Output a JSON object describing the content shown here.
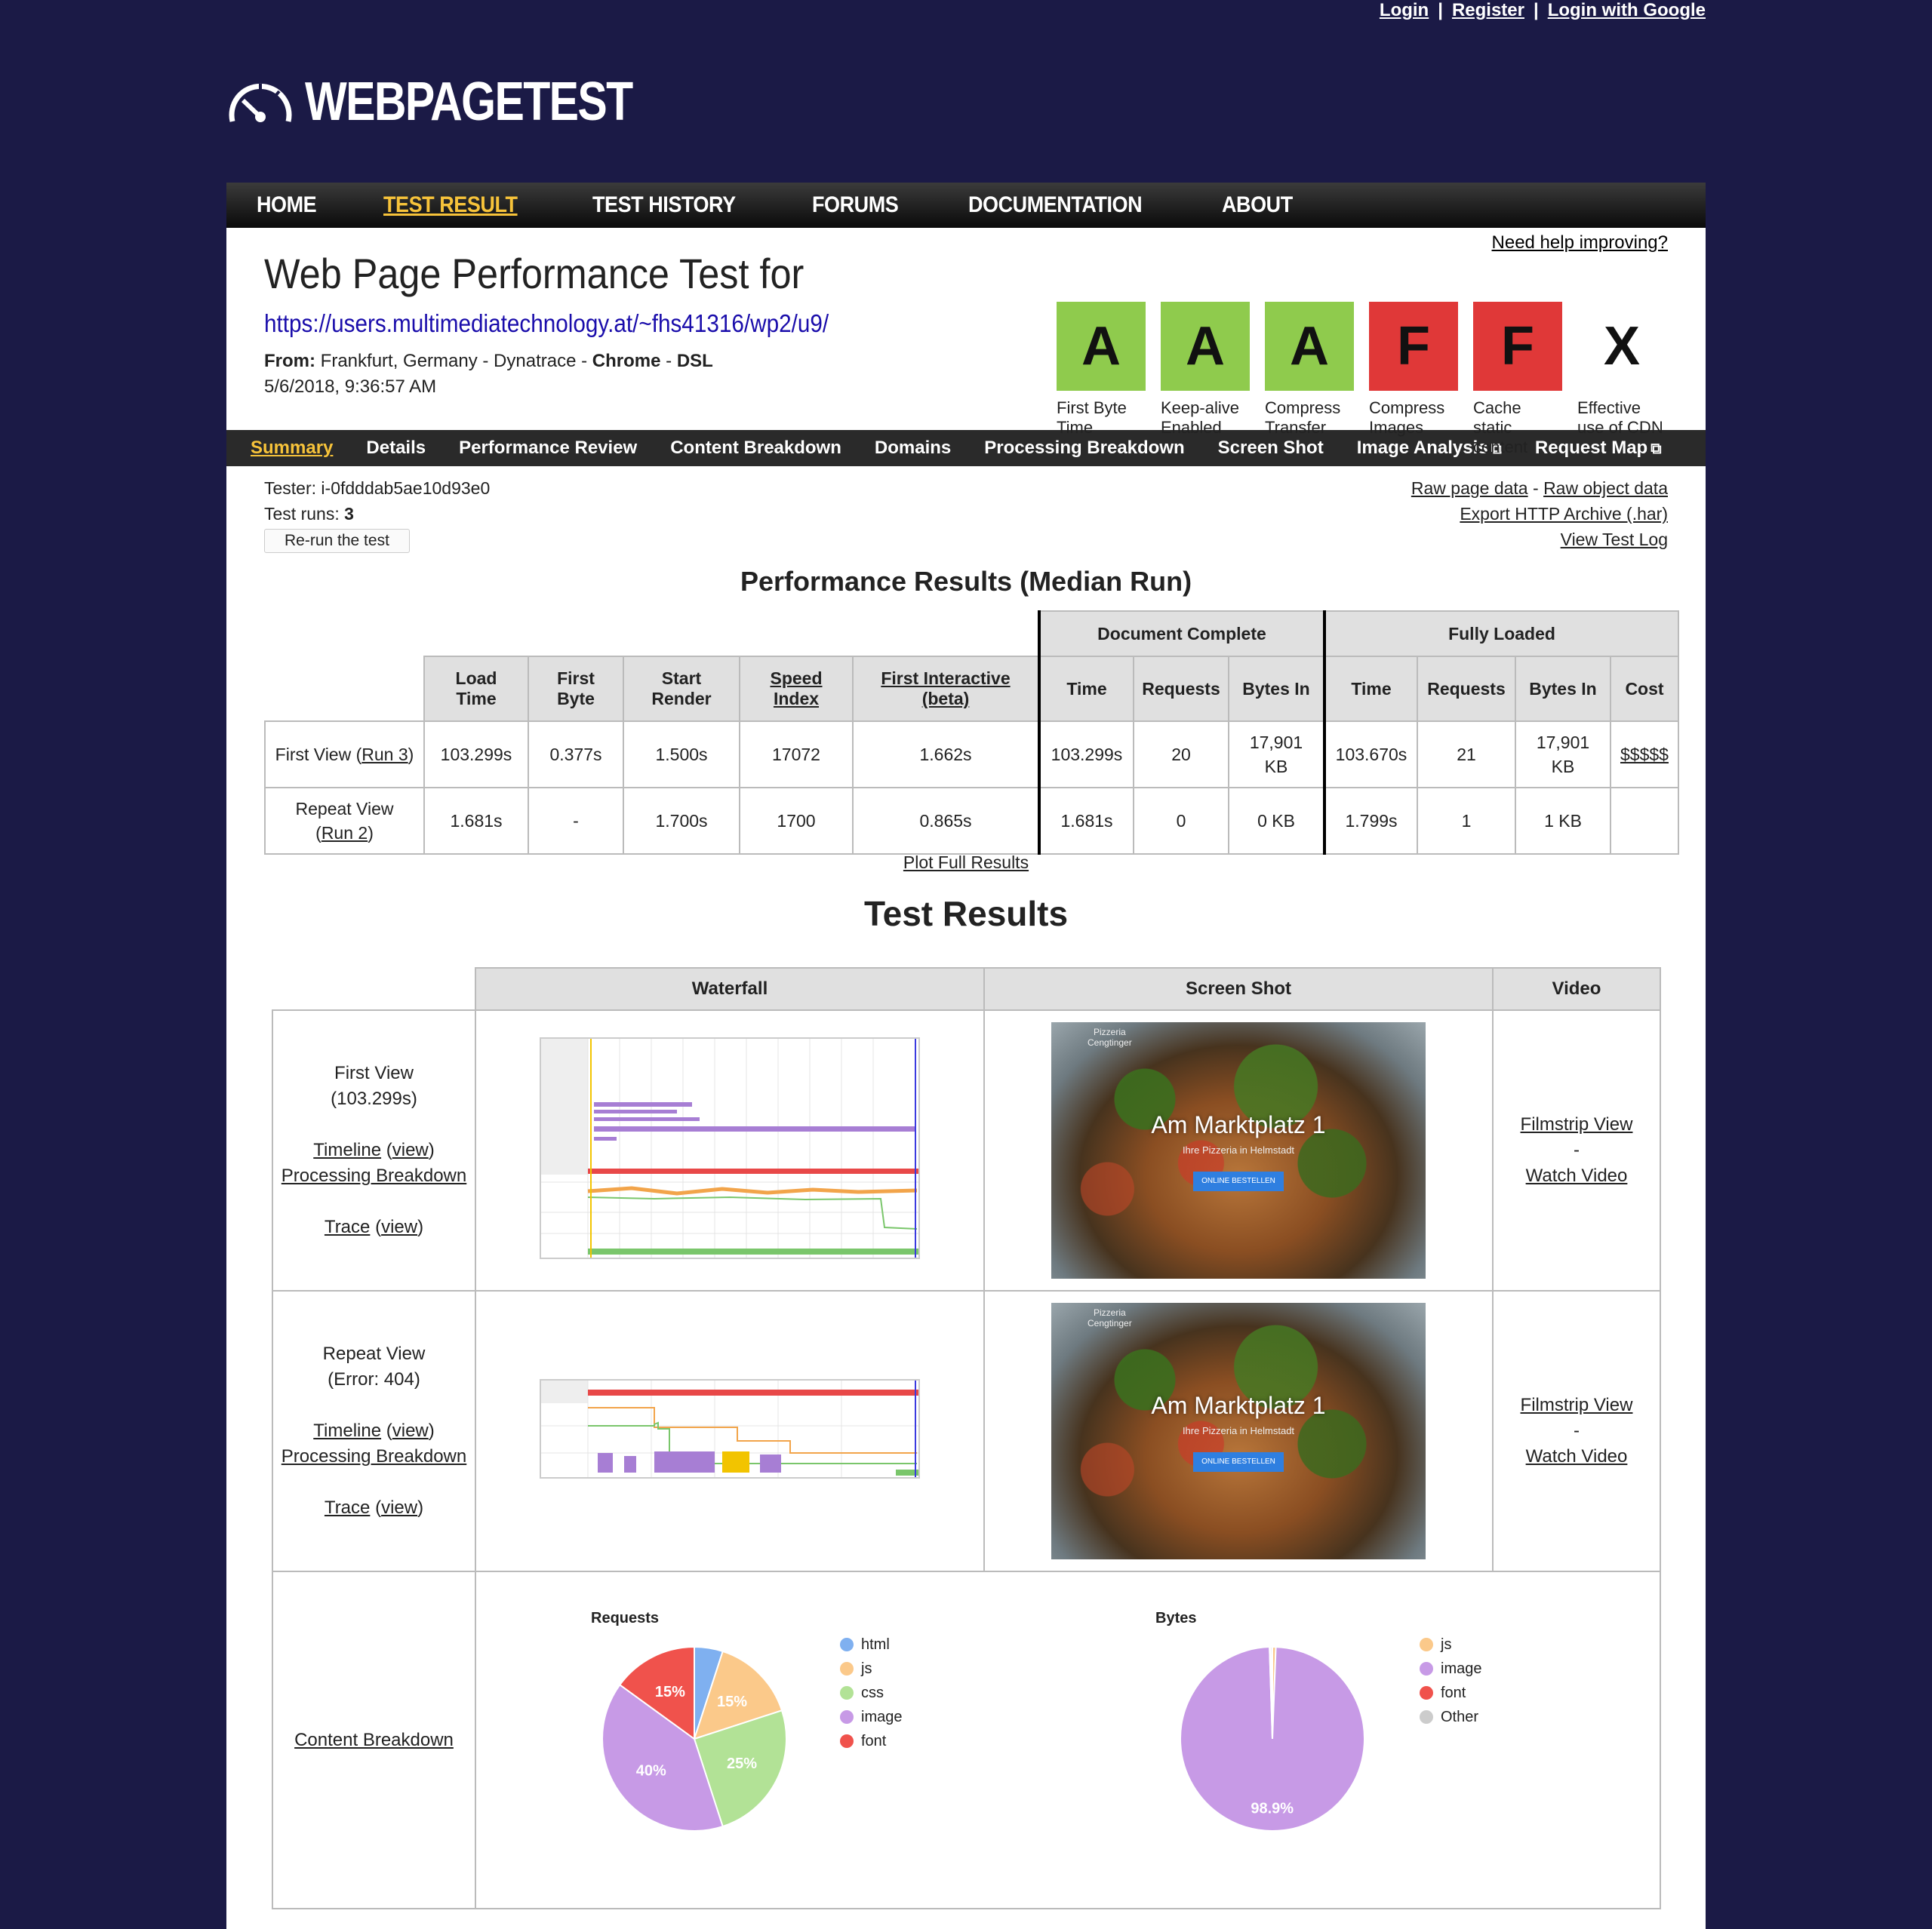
{
  "topbar": {
    "login": "Login",
    "sep": "|",
    "register": "Register",
    "login_google": "Login with Google"
  },
  "logo": {
    "text": "WEBPAGETEST"
  },
  "mainnav": [
    "HOME",
    "TEST RESULT",
    "TEST HISTORY",
    "FORUMS",
    "DOCUMENTATION",
    "ABOUT"
  ],
  "header": {
    "title": "Web Page Performance Test for",
    "url": "https://users.multimediatechnology.at/~fhs41316/wp2/u9/",
    "from_label": "From:",
    "from_text": "Frankfurt, Germany - Dynatrace -",
    "browser": "Chrome",
    "dash": "-",
    "connection": "DSL",
    "date": "5/6/2018, 9:36:57 AM",
    "help": "Need help improving?"
  },
  "grades": [
    {
      "letter": "A",
      "label1": "First Byte",
      "label2": "Time",
      "label3": "",
      "color": "#8fcb4d"
    },
    {
      "letter": "A",
      "label1": "Keep-alive",
      "label2": "Enabled",
      "label3": "",
      "color": "#8fcb4d"
    },
    {
      "letter": "A",
      "label1": "Compress",
      "label2": "Transfer",
      "label3": "",
      "color": "#8fcb4d"
    },
    {
      "letter": "F",
      "label1": "Compress",
      "label2": "Images",
      "label3": "",
      "color": "#e03838"
    },
    {
      "letter": "F",
      "label1": "Cache",
      "label2": "static",
      "label3": "content",
      "color": "#e03838"
    },
    {
      "letter": "X",
      "label1": "Effective",
      "label2": "use of CDN",
      "label3": "",
      "color": "#ffffff"
    }
  ],
  "subnav": [
    "Summary",
    "Details",
    "Performance Review",
    "Content Breakdown",
    "Domains",
    "Processing Breakdown",
    "Screen Shot",
    "Image Analysis",
    "Request Map"
  ],
  "info": {
    "tester_label": "Tester:",
    "tester": "i-0fdddab5ae10d93e0",
    "runs_label": "Test runs:",
    "runs": "3",
    "rerun": "Re-run the test",
    "raw_page": "Raw page data",
    "dash": "-",
    "raw_object": "Raw object data",
    "export_har": "Export HTTP Archive (.har)",
    "test_log": "View Test Log"
  },
  "perf": {
    "title": "Performance Results (Median Run)",
    "group_doc": "Document Complete",
    "group_full": "Fully Loaded",
    "cols": {
      "load": [
        "Load",
        "Time"
      ],
      "fb": [
        "First",
        "Byte"
      ],
      "sr": [
        "Start",
        "Render"
      ],
      "si": [
        "Speed",
        "Index"
      ],
      "fi": [
        "First Interactive",
        "(beta)"
      ],
      "time": "Time",
      "requests": "Requests",
      "bytes": "Bytes In",
      "cost": "Cost"
    },
    "rows": [
      {
        "label": "First View (",
        "run": "Run 3",
        "close": ")",
        "load": "103.299s",
        "fb": "0.377s",
        "sr": "1.500s",
        "si": "17072",
        "fi": "1.662s",
        "dc_time": "103.299s",
        "dc_req": "20",
        "dc_bytes1": "17,901",
        "dc_bytes2": "KB",
        "fl_time": "103.670s",
        "fl_req": "21",
        "fl_bytes1": "17,901",
        "fl_bytes2": "KB",
        "cost": "$$$$$"
      },
      {
        "label": "Repeat View",
        "run": "Run 2",
        "open": "(",
        "close": ")",
        "load": "1.681s",
        "fb": "-",
        "sr": "1.700s",
        "si": "1700",
        "fi": "0.865s",
        "dc_time": "1.681s",
        "dc_req": "0",
        "dc_bytes": "0 KB",
        "fl_time": "1.799s",
        "fl_req": "1",
        "fl_bytes": "1 KB",
        "cost": ""
      }
    ],
    "plot_link": "Plot Full Results"
  },
  "results": {
    "title": "Test Results",
    "headers": [
      "Waterfall",
      "Screen Shot",
      "Video"
    ],
    "first": {
      "name": "First View",
      "time": "(103.299s)"
    },
    "repeat": {
      "name": "Repeat View",
      "time": "(Error: 404)"
    },
    "links": {
      "timeline": "Timeline",
      "view": "view",
      "open": "(",
      "close": ")",
      "processing": "Processing Breakdown",
      "trace": "Trace",
      "filmstrip": "Filmstrip View",
      "dash": "-",
      "watch": "Watch Video",
      "content": "Content Breakdown"
    },
    "shot": {
      "brand1": "Pizzeria",
      "brand2": "Cengtinger",
      "heading": "Am Marktplatz 1",
      "sub": "Ihre Pizzeria in Helmstadt",
      "button": "ONLINE BESTELLEN"
    }
  },
  "chart_data": [
    {
      "type": "pie",
      "title": "Requests",
      "categories": [
        "html",
        "js",
        "css",
        "image",
        "font"
      ],
      "values": [
        5,
        15,
        25,
        40,
        15
      ],
      "labels": [
        "",
        "15%",
        "25%",
        "40%",
        "15%"
      ],
      "colors": [
        "#7fb0f0",
        "#fbc98a",
        "#b2e296",
        "#c79ae6",
        "#f0524c"
      ],
      "legend": "right"
    },
    {
      "type": "pie",
      "title": "Bytes",
      "categories": [
        "js",
        "image",
        "font",
        "Other"
      ],
      "values": [
        0.6,
        98.9,
        0.2,
        0.3
      ],
      "labels": [
        "",
        "98.9%",
        "",
        ""
      ],
      "colors": [
        "#fbc98a",
        "#c79ae6",
        "#f0524c",
        "#cccccc"
      ],
      "legend": "right"
    }
  ]
}
